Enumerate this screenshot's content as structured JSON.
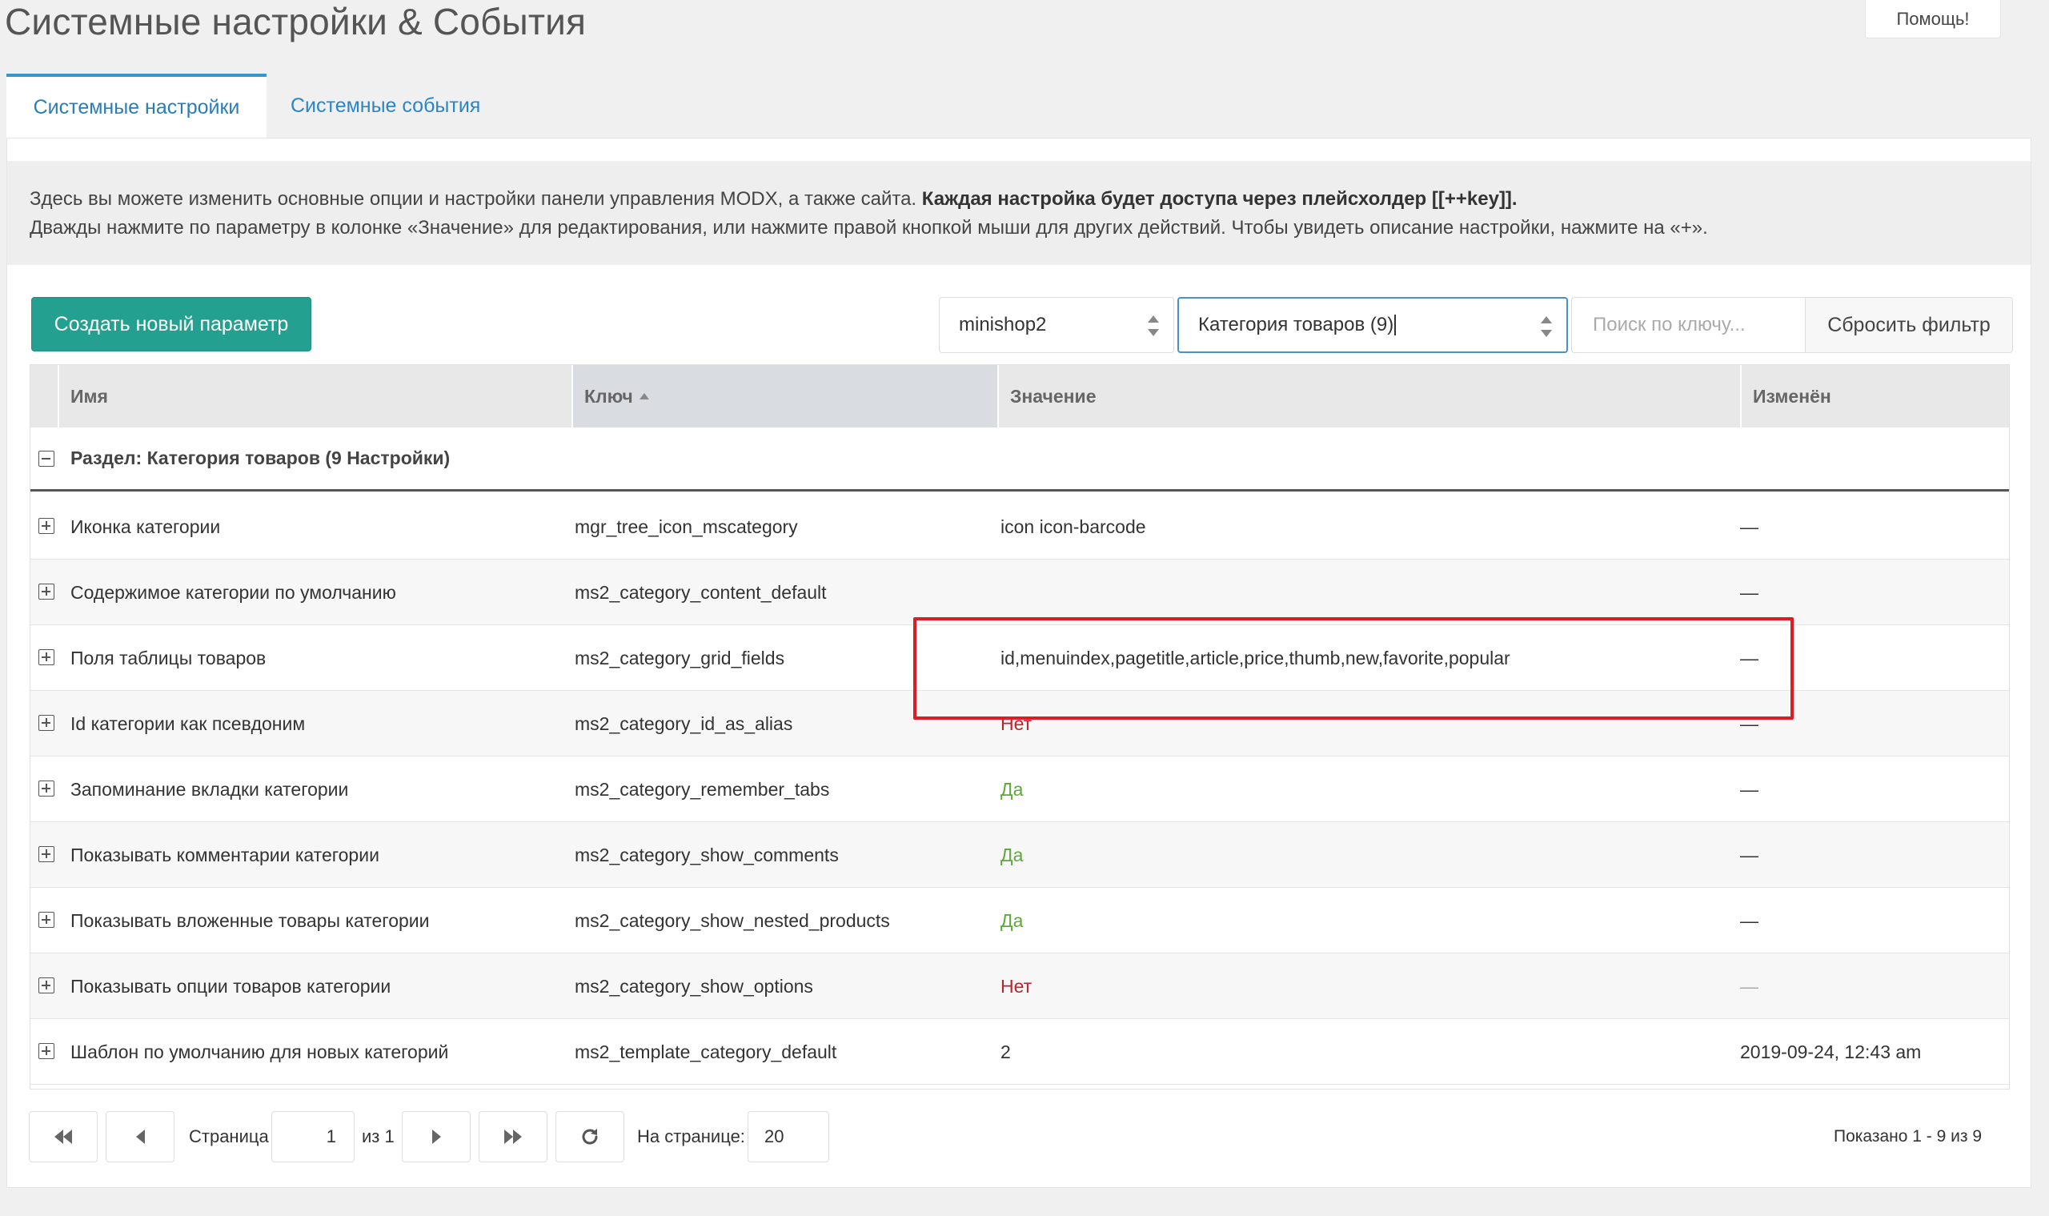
{
  "page": {
    "title": "Системные настройки & События",
    "help_label": "Помощь!"
  },
  "tabs": [
    {
      "label": "Системные настройки",
      "active": true
    },
    {
      "label": "Системные события",
      "active": false
    }
  ],
  "description": {
    "line1_plain": "Здесь вы можете изменить основные опции и настройки панели управления MODX, а также сайта. ",
    "line1_bold": "Каждая настройка будет доступа через плейсхолдер [[++key]].",
    "line2": "Дважды нажмите по параметру в колонке «Значение» для редактирования, или нажмите правой кнопкой мыши для других действий. Чтобы увидеть описание настройки, нажмите на «+»."
  },
  "toolbar": {
    "create_label": "Создать новый параметр",
    "namespace_value": "minishop2",
    "area_value": "Категория товаров (9)",
    "search_placeholder": "Поиск по ключу...",
    "reset_label": "Сбросить фильтр"
  },
  "grid": {
    "columns": {
      "name": "Имя",
      "key": "Ключ",
      "value": "Значение",
      "changed": "Изменён"
    },
    "group_label": "Раздел: Категория товаров (9 Настройки)",
    "rows": [
      {
        "name": "Иконка категории",
        "key": "mgr_tree_icon_mscategory",
        "value": "icon icon-barcode",
        "changed": "—"
      },
      {
        "name": "Содержимое категории по умолчанию",
        "key": "ms2_category_content_default",
        "value": "",
        "changed": "—"
      },
      {
        "name": "Поля таблицы товаров",
        "key": "ms2_category_grid_fields",
        "value": "id,menuindex,pagetitle,article,price,thumb,new,favorite,popular",
        "changed": "—"
      },
      {
        "name": "Id категории как псевдоним",
        "key": "ms2_category_id_as_alias",
        "value": "Нет",
        "changed": "—"
      },
      {
        "name": "Запоминание вкладки категории",
        "key": "ms2_category_remember_tabs",
        "value": "Да",
        "changed": "—"
      },
      {
        "name": "Показывать комментарии категории",
        "key": "ms2_category_show_comments",
        "value": "Да",
        "changed": "—"
      },
      {
        "name": "Показывать вложенные товары категории",
        "key": "ms2_category_show_nested_products",
        "value": "Да",
        "changed": "—"
      },
      {
        "name": "Показывать опции товаров категории",
        "key": "ms2_category_show_options",
        "value": "Нет",
        "changed": "—"
      },
      {
        "name": "Шаблон по умолчанию для новых категорий",
        "key": "ms2_template_category_default",
        "value": "2",
        "changed": "2019-09-24, 12:43 am"
      }
    ]
  },
  "pager": {
    "page_label": "Страница",
    "page_value": "1",
    "of_label": "из 1",
    "per_page_label": "На странице:",
    "per_page_value": "20",
    "shown_label": "Показано 1 - 9 из 9"
  },
  "colors": {
    "accent": "#23a08f",
    "tab_link": "#2a86c5",
    "value_no": "#b5262d",
    "value_yes": "#5fa83d",
    "highlight": "#dd1c23"
  }
}
